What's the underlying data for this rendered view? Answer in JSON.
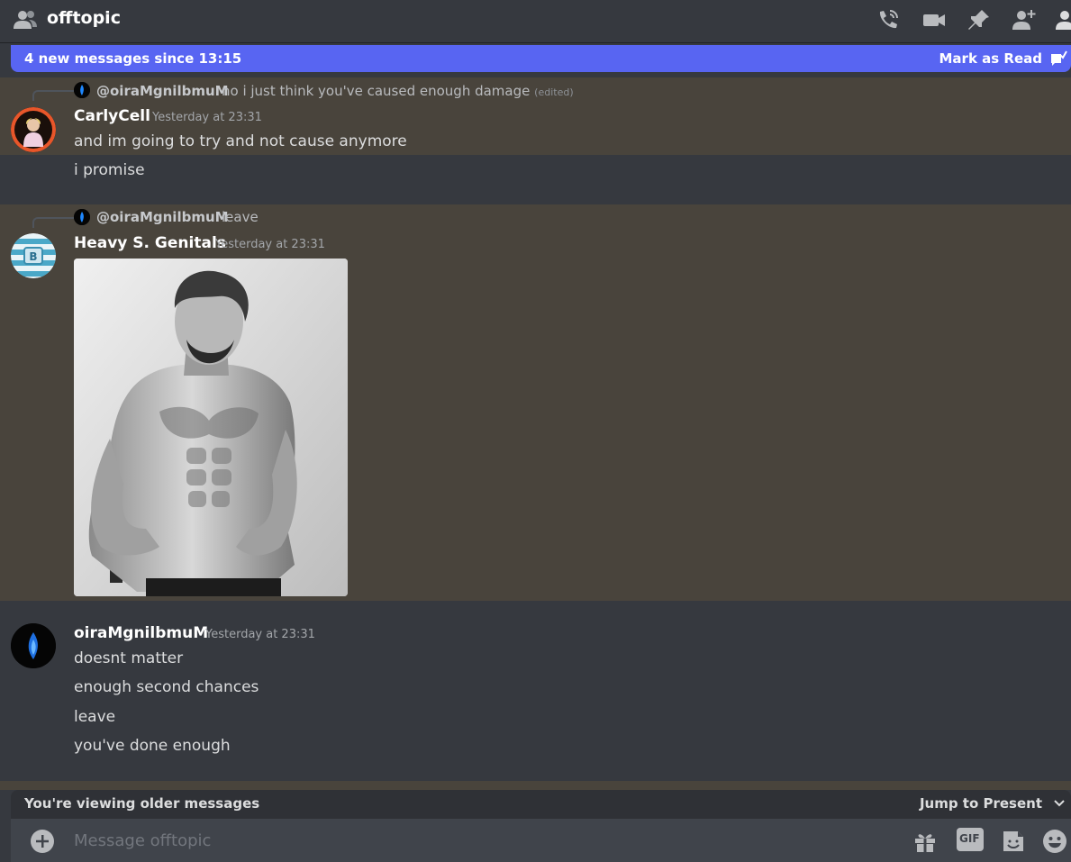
{
  "header": {
    "channel_name": "offtopic",
    "icons": [
      "people-icon",
      "call-icon",
      "video-icon",
      "pin-icon",
      "add-member-icon",
      "member-list-icon"
    ]
  },
  "new_messages_bar": {
    "text": "4 new messages since 13:15",
    "action_label": "Mark as Read"
  },
  "messages": [
    {
      "reply_to": {
        "author": "@oiraMgnilbmuM",
        "text": "no i just think you've caused enough damage",
        "edited_label": "(edited)"
      },
      "author": "CarlyCell",
      "timestamp": "Yesterday at 23:31",
      "lines": [
        "and im going to try and not cause anymore",
        "i promise"
      ]
    },
    {
      "reply_to": {
        "author": "@oiraMgnilbmuM",
        "text": "leave"
      },
      "author": "Heavy S. Genitals",
      "timestamp": "Yesterday at 23:31",
      "attachment": "image"
    },
    {
      "author": "oiraMgnilbmuM",
      "timestamp": "Yesterday at 23:31",
      "lines": [
        "doesnt matter",
        "enough second chances",
        "leave",
        "you've done enough"
      ]
    }
  ],
  "older_bar": {
    "text": "You're viewing older messages",
    "action_label": "Jump to Present"
  },
  "composer": {
    "placeholder": "Message offtopic",
    "buttons": [
      "gift-icon",
      "gif-icon",
      "sticker-icon",
      "emoji-icon"
    ],
    "gif_label": "GIF"
  },
  "colors": {
    "background": "#36393f",
    "highlight": "#49443c",
    "accent": "#5865f2"
  }
}
